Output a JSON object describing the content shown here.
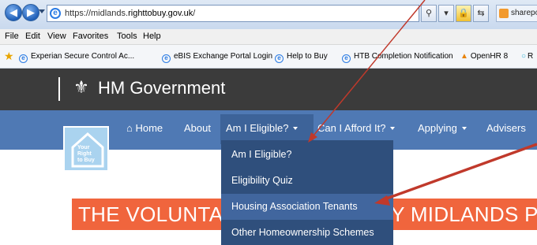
{
  "browser": {
    "url_prefix": "https://midlands.",
    "url_domain": "righttobuy.gov.uk",
    "url_suffix": "/",
    "tab_label": "sharepoin",
    "back_icon": "back-arrow-icon",
    "forward_icon": "forward-arrow-icon"
  },
  "menu": [
    "File",
    "Edit",
    "View",
    "Favorites",
    "Tools",
    "Help"
  ],
  "favorites": [
    {
      "label": "Experian Secure Control Ac..."
    },
    {
      "label": "eBIS Exchange Portal Login"
    },
    {
      "label": "Help to Buy"
    },
    {
      "label": "HTB Completion Notification"
    },
    {
      "label": "OpenHR 8"
    },
    {
      "label": "R"
    }
  ],
  "site": {
    "gov_title": "HM Government",
    "logo_text": "Your\nRight\nto Buy",
    "nav": {
      "home": "Home",
      "about": "About",
      "eligible": "Am I Eligible?",
      "afford": "Can I Afford It?",
      "applying": "Applying",
      "advisers": "Advisers"
    },
    "dropdown": [
      "Am I Eligible?",
      "Eligibility Quiz",
      "Housing Association Tenants",
      "Other Homeownership Schemes"
    ],
    "banner": "THE VOLUNTARY RIGHT TO BUY MIDLANDS P"
  },
  "colors": {
    "gov_bar": "#3b3b3b",
    "nav_bar": "#4f79b4",
    "dropdown": "#2f4f7c",
    "dropdown_highlight": "#41669e",
    "banner": "#f0653d",
    "annotation_arrow": "#c0392b"
  }
}
